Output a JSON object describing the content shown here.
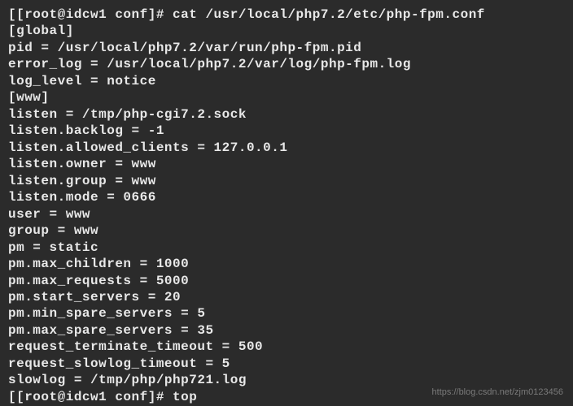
{
  "prompt1": "[[root@idcw1 conf]# cat /usr/local/php7.2/etc/php-fpm.conf",
  "lines": [
    "[global]",
    "pid = /usr/local/php7.2/var/run/php-fpm.pid",
    "error_log = /usr/local/php7.2/var/log/php-fpm.log",
    "log_level = notice",
    "",
    "[www]",
    "listen = /tmp/php-cgi7.2.sock",
    "listen.backlog = -1",
    "listen.allowed_clients = 127.0.0.1",
    "listen.owner = www",
    "listen.group = www",
    "listen.mode = 0666",
    "user = www",
    "group = www",
    "pm = static",
    "pm.max_children = 1000",
    "pm.max_requests = 5000",
    "pm.start_servers = 20",
    "pm.min_spare_servers = 5",
    "pm.max_spare_servers = 35",
    "request_terminate_timeout = 500",
    "request_slowlog_timeout = 5",
    "slowlog = /tmp/php/php721.log"
  ],
  "prompt2": "[[root@idcw1 conf]# top",
  "watermark": "https://blog.csdn.net/zjm0123456"
}
